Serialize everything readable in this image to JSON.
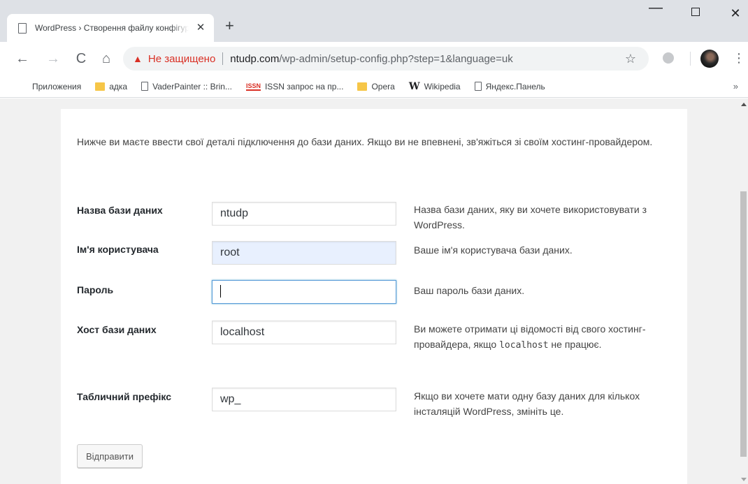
{
  "browser": {
    "tab_title": "WordPress › Створення файлу конфігурації",
    "new_tab_symbol": "+",
    "close_tab_symbol": "✕",
    "window": {
      "minimize": "—",
      "close": "✕"
    },
    "security_label": "Не защищено",
    "url_host": "ntudp.com",
    "url_path": "/wp-admin/setup-config.php?step=1&language=uk",
    "bookmarks": [
      {
        "label": "Приложения",
        "icon": "apps-grid-icon"
      },
      {
        "label": "адка",
        "icon": "folder-icon"
      },
      {
        "label": "VaderPainter :: Brin...",
        "icon": "page-icon"
      },
      {
        "label": "ISSN запрос на пр...",
        "icon": "issn-icon"
      },
      {
        "label": "Opera",
        "icon": "folder-icon"
      },
      {
        "label": "Wikipedia",
        "icon": "wikipedia-icon"
      },
      {
        "label": "Яндекс.Панель",
        "icon": "page-icon"
      }
    ],
    "bookmarks_more": "»"
  },
  "page": {
    "intro": "Нижче ви маєте ввести свої деталі підключення до бази даних. Якщо ви не впевнені, зв'яжіться зі своїм хостинг-провайдером.",
    "fields": [
      {
        "label": "Назва бази даних",
        "value": "ntudp",
        "help": "Назва бази даних, яку ви хочете використовувати з WordPress."
      },
      {
        "label": "Ім'я користувача",
        "value": "root",
        "help": "Ваше ім'я користувача бази даних."
      },
      {
        "label": "Пароль",
        "value": "",
        "help": "Ваш пароль бази даних."
      },
      {
        "label": "Хост бази даних",
        "value": "localhost",
        "help_pre": "Ви можете отримати ці відомості від свого хостинг-провайдера, якщо ",
        "help_code": "localhost",
        "help_post": " не працює."
      },
      {
        "label": "Табличний префікс",
        "value": "wp_",
        "help": "Якщо ви хочете мати одну базу даних для кількох інсталяцій WordPress, змініть це."
      }
    ],
    "submit_label": "Відправити"
  },
  "colors": {
    "insecure": "#d93025",
    "autofill_bg": "#e8f0fe",
    "focus_border": "#5b9dd9"
  }
}
